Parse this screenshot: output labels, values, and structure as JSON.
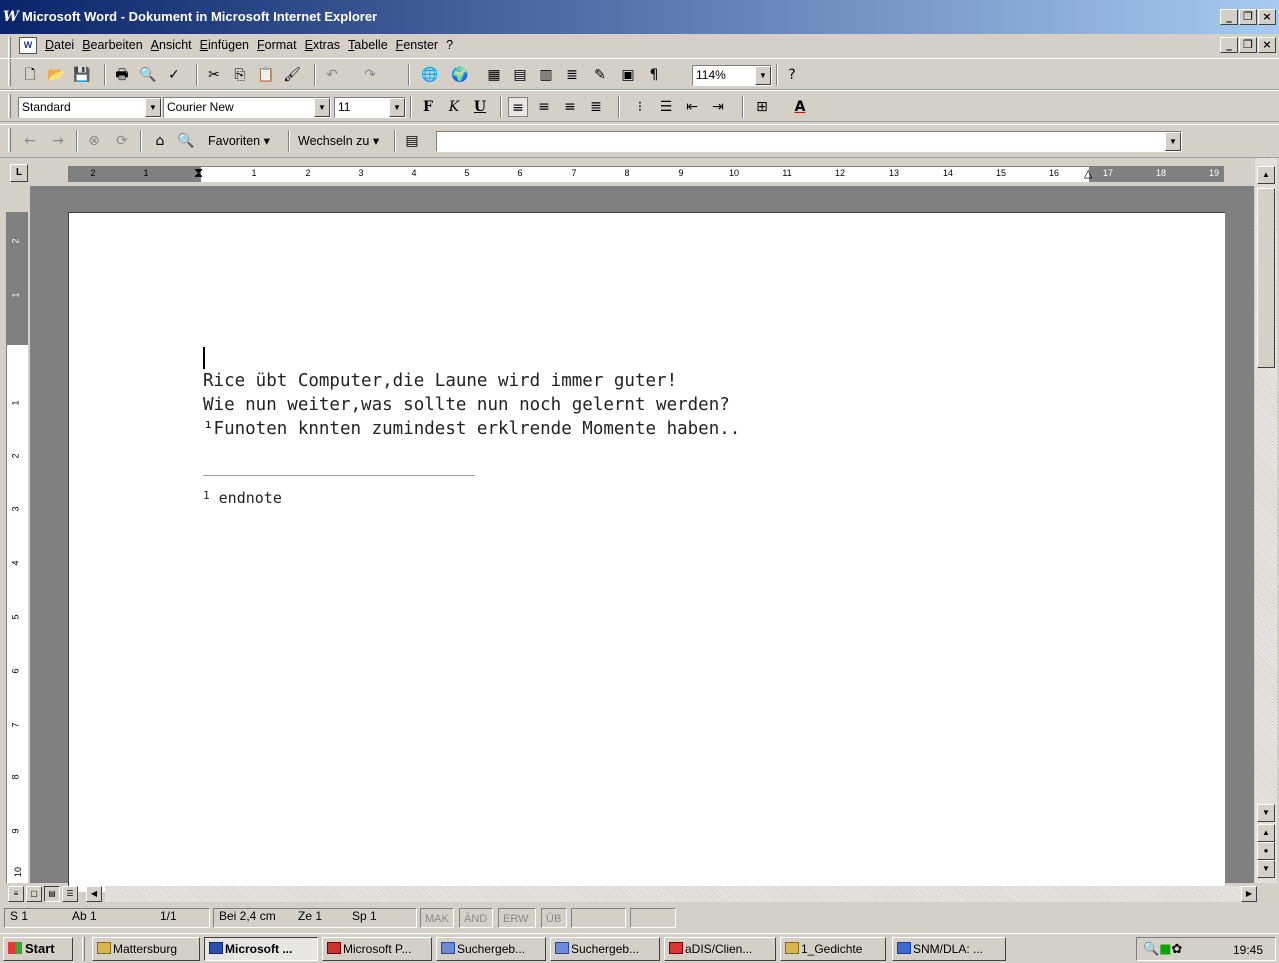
{
  "window": {
    "title": "Microsoft Word - Dokument in Microsoft Internet Explorer",
    "app_icon": "W",
    "controls": [
      "_",
      "❐",
      "×"
    ]
  },
  "menu": {
    "items": [
      "Datei",
      "Bearbeiten",
      "Ansicht",
      "Einfügen",
      "Format",
      "Extras",
      "Tabelle",
      "Fenster",
      "?"
    ]
  },
  "formatting": {
    "style": "Standard",
    "font": "Courier New",
    "size": "11",
    "zoom": "114%",
    "bold": "F",
    "italic": "K",
    "underline": "U"
  },
  "web_toolbar": {
    "favorites": "Favoriten",
    "goto": "Wechseln zu",
    "address": ""
  },
  "ruler": {
    "labels": [
      "2",
      "1",
      "1",
      "2",
      "3",
      "4",
      "5",
      "6",
      "7",
      "8",
      "9",
      "10",
      "11",
      "12",
      "13",
      "14",
      "15",
      "16",
      "17",
      "18",
      "19"
    ],
    "vlabels": [
      "2",
      "1",
      "1",
      "2",
      "3",
      "4",
      "5",
      "6",
      "7",
      "8",
      "9",
      "10"
    ]
  },
  "document": {
    "lines": [
      "Rice übt Computer,die Laune wird immer guter!",
      "Wie nun weiter,was sollte nun noch gelernt werden?",
      "¹Funoten knnten zumindest erklrende Momente haben.."
    ],
    "footnote_mark": "1",
    "footnote_text": "endnote"
  },
  "status": {
    "page": "S 1",
    "section": "Ab 1",
    "pages": "1/1",
    "position": "Bei 2,4 cm",
    "line": "Ze 1",
    "column": "Sp 1",
    "mak": "MAK",
    "and": "ÄND",
    "erw": "ERW",
    "ub": "ÜB"
  },
  "taskbar": {
    "start": "Start",
    "tasks": [
      "Mattersburg",
      "Microsoft ...",
      "Microsoft P...",
      "Suchergeb...",
      "Suchergeb...",
      "aDIS/Clien...",
      "1_Gedichte",
      "SNM/DLA: ..."
    ],
    "clock": "19:45"
  }
}
